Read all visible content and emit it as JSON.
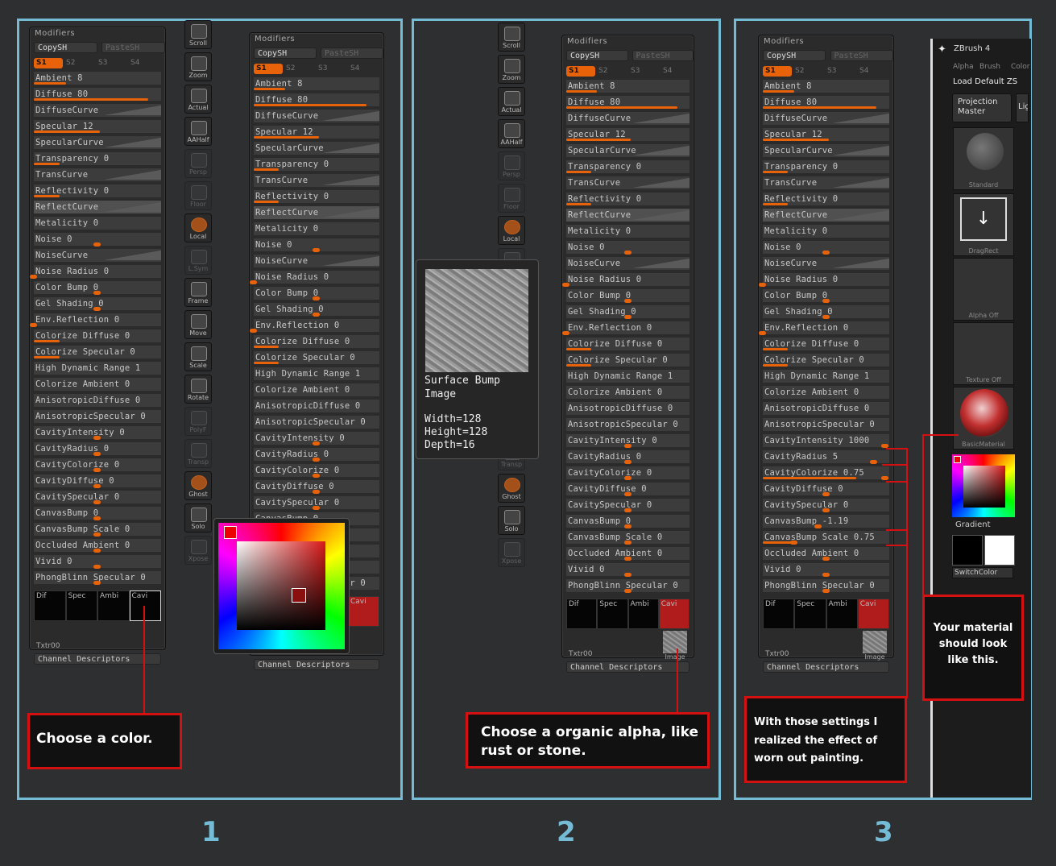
{
  "labels": {
    "modifiers": "Modifiers",
    "copy": "CopySH",
    "paste": "PasteSH",
    "s": [
      "S1",
      "S2",
      "S3",
      "S4"
    ],
    "channels": [
      "Dif",
      "Spec",
      "Ambi",
      "Cavi"
    ],
    "txtr": "Txtr00",
    "channel_descriptors": "Channel Descriptors",
    "image_label": "Image"
  },
  "rows_base": [
    "Ambient 8",
    "Diffuse 80",
    "DiffuseCurve",
    "Specular 12",
    "SpecularCurve",
    "Transparency 0",
    "TransCurve",
    "Reflectivity 0",
    "ReflectCurve",
    "Metalicity 0",
    "Noise 0",
    "NoiseCurve",
    "Noise Radius 0",
    "Color Bump 0",
    "Gel Shading 0",
    "Env.Reflection 0",
    "Colorize Diffuse 0",
    "Colorize Specular 0",
    "High Dynamic Range 1",
    "Colorize Ambient 0",
    "AnisotropicDiffuse 0",
    "AnisotropicSpecular 0",
    "CavityIntensity 0",
    "CavityRadius 0",
    "CavityColorize 0",
    "CavityDiffuse 0",
    "CavitySpecular 0",
    "CanvasBump 0",
    "CanvasBump Scale 0",
    "Occluded  Ambient 0",
    "Vivid 0",
    "PhongBlinn Specular 0"
  ],
  "rows_step3_cavity": [
    "CavityIntensity 1000",
    "CavityRadius 5",
    "CavityColorize 0.75",
    "CavityDiffuse 0",
    "CavitySpecular 0",
    "CanvasBump -1.19",
    "CanvasBump Scale 0.75"
  ],
  "toolbar": [
    "Scroll",
    "Zoom",
    "Actual",
    "AAHalf",
    "Persp",
    "Floor",
    "Local",
    "L.Sym",
    "Frame",
    "Move",
    "Scale",
    "Rotate",
    "PolyF",
    "Transp",
    "Ghost",
    "Solo",
    "Xpose"
  ],
  "tooltip": {
    "title": "Surface Bump",
    "subtitle": "Image",
    "width": "Width=128",
    "height": "Height=128",
    "depth": "Depth=16"
  },
  "zbrush": {
    "title": "ZBrush 4",
    "menu": [
      "Alpha",
      "Brush",
      "Color"
    ],
    "load": "Load Default",
    "load_suffix": "ZS",
    "projection": "Projection Master",
    "light": "Lig",
    "tiles": [
      "Standard",
      "DragRect",
      "Alpha  Off",
      "Texture  Off",
      "BasicMaterial"
    ],
    "gradient": "Gradient",
    "switch": "SwitchColor"
  },
  "callouts": {
    "one": "Choose a color.",
    "two": "Choose a organic alpha, like rust or stone.",
    "three": "With those settings I realized the effect of worn out painting.",
    "four": "Your material should look like this."
  },
  "steps": [
    "1",
    "2",
    "3"
  ],
  "colors": {
    "accent": "#e8620a",
    "frame": "#74bcd6",
    "callout": "#d51010",
    "cavity": "#b01c1c"
  }
}
